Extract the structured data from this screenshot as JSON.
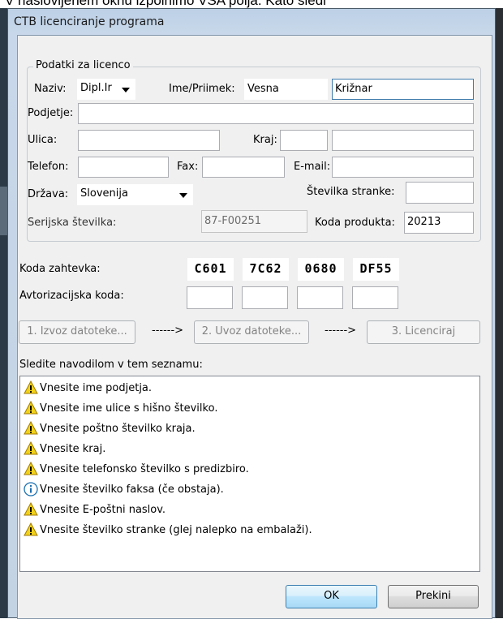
{
  "behind_text": "V naslovljenem oknu izpolnimo VSA polja. Kato sledi",
  "window": {
    "title": "CTB licenciranje programa"
  },
  "group": {
    "title": "Podatki za licenco",
    "naziv_label": "Naziv:",
    "naziv_value": "Dipl.Ir",
    "ime_label": "Ime/Priimek:",
    "ime_value": "Vesna",
    "priimek_value": "Križnar",
    "podjetje_label": "Podjetje:",
    "podjetje_value": "",
    "ulica_label": "Ulica:",
    "ulica_value": "",
    "kraj_label": "Kraj:",
    "postna_value": "",
    "kraj_value": "",
    "telefon_label": "Telefon:",
    "telefon_value": "",
    "fax_label": "Fax:",
    "fax_value": "",
    "email_label": "E-mail:",
    "email_value": "",
    "drzava_label": "Država:",
    "drzava_value": "Slovenija",
    "stevilka_stranke_label": "Številka stranke:",
    "stevilka_stranke_value": "",
    "serijska_label": "Serijska številka:",
    "serijska_value": "87-F00251",
    "koda_produkta_label": "Koda produkta:",
    "koda_produkta_value": "20213"
  },
  "request": {
    "koda_label": "Koda zahtevka:",
    "codes": [
      "C601",
      "7C62",
      "0680",
      "DF55"
    ],
    "avtorizacijska_label": "Avtorizacijska koda:"
  },
  "steps": {
    "step1": "1. Izvoz datoteke...",
    "arrow": "------>",
    "step2": "2. Uvoz datoteke...",
    "step3": "3. Licenciraj"
  },
  "instructions": {
    "label": "Sledite navodilom v tem seznamu:",
    "items": [
      {
        "icon": "warning-icon",
        "text": "Vnesite ime podjetja."
      },
      {
        "icon": "warning-icon",
        "text": "Vnesite ime ulice s hišno številko."
      },
      {
        "icon": "warning-icon",
        "text": "Vnesite poštno številko kraja."
      },
      {
        "icon": "warning-icon",
        "text": "Vnesite kraj."
      },
      {
        "icon": "warning-icon",
        "text": "Vnesite telefonsko številko s predizbiro."
      },
      {
        "icon": "info-icon",
        "text": "Vnesite številko faksa (če obstaja)."
      },
      {
        "icon": "warning-icon",
        "text": "Vnesite E-poštni naslov."
      },
      {
        "icon": "warning-icon",
        "text": "Vnesite številko stranke (glej nalepko na embalaži)."
      }
    ]
  },
  "buttons": {
    "ok": "OK",
    "cancel": "Prekini"
  },
  "colors": {
    "warning": "#f2d21a",
    "info": "#1a6fb0",
    "window_frame": "#c3d3e4"
  }
}
